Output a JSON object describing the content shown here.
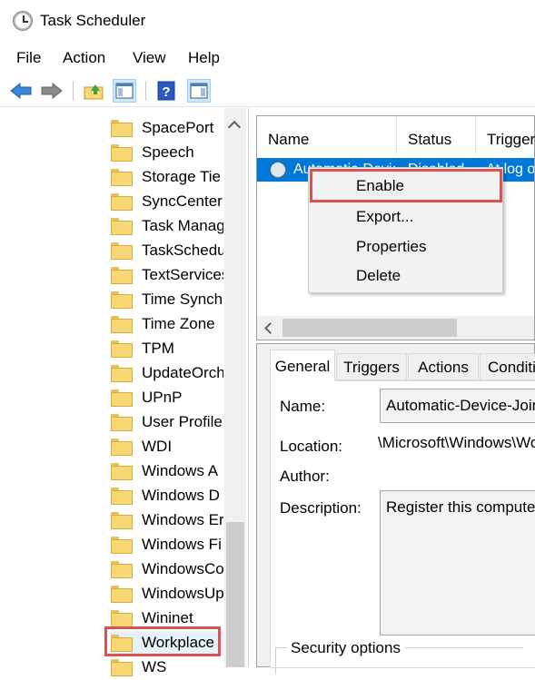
{
  "window": {
    "title": "Task Scheduler"
  },
  "menu": {
    "items": [
      "File",
      "Action",
      "View",
      "Help"
    ]
  },
  "toolbar": {
    "icons": [
      "back-arrow-icon",
      "forward-arrow-icon",
      "up-folder-icon",
      "show-hide-console-tree-icon",
      "help-icon",
      "show-action-pane-icon"
    ]
  },
  "tree": {
    "items": [
      "SpacePort",
      "Speech",
      "Storage Tie",
      "SyncCenter",
      "Task Manag",
      "TaskSchedu",
      "TextServices",
      "Time Synch",
      "Time Zone",
      "TPM",
      "UpdateOrch",
      "UPnP",
      "User Profile",
      "WDI",
      "Windows A",
      "Windows D",
      "Windows Er",
      "Windows Fi",
      "WindowsCo",
      "WindowsUp",
      "Wininet",
      "Workplace",
      "WS"
    ],
    "selected": "Workplace"
  },
  "task_list": {
    "columns": [
      "Name",
      "Status",
      "Trigger"
    ],
    "row": {
      "name": "Automatic-Device-Join",
      "status": "Disabled",
      "trigger": "At log on"
    }
  },
  "context_menu": {
    "items": [
      "Enable",
      "Export...",
      "Properties",
      "Delete"
    ],
    "highlighted": "Enable"
  },
  "details": {
    "tabs": [
      "General",
      "Triggers",
      "Actions",
      "Conditions"
    ],
    "active_tab": "General",
    "name_label": "Name:",
    "name_value": "Automatic-Device-Join",
    "location_label": "Location:",
    "location_value": "\\Microsoft\\Windows\\Workplace",
    "author_label": "Author:",
    "description_label": "Description:",
    "description_value": "Register this computer",
    "security_label": "Security options"
  },
  "colors": {
    "selection": "#0078d7",
    "highlight_box": "#d9534f"
  }
}
